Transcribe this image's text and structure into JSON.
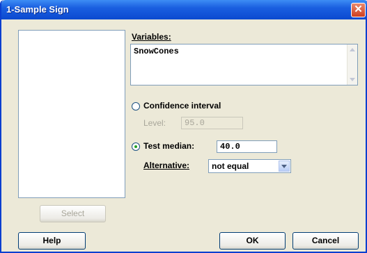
{
  "window": {
    "title": "1-Sample Sign",
    "close_symbol": "✕"
  },
  "variables": {
    "label": "Variables:",
    "value": "SnowCones"
  },
  "confidence": {
    "label": "Confidence interval",
    "selected": false,
    "level_label": "Level:",
    "level_value": "95.0",
    "enabled": false
  },
  "test_median": {
    "label": "Test median:",
    "selected": true,
    "value": "40.0"
  },
  "alternative": {
    "label": "Alternative:",
    "value": "not equal"
  },
  "buttons": {
    "select": "Select",
    "help": "Help",
    "ok": "OK",
    "cancel": "Cancel"
  }
}
